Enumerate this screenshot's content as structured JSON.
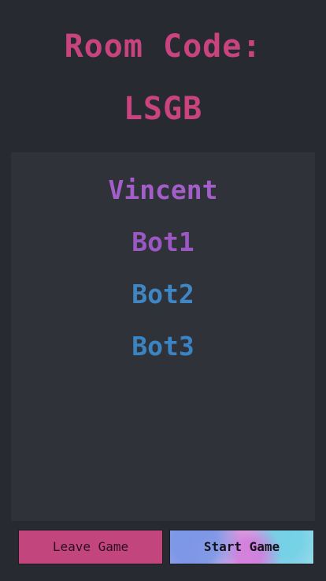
{
  "room": {
    "label": "Room Code:",
    "code": "LSGB"
  },
  "players": [
    {
      "name": "Vincent",
      "color": "#a45ec9"
    },
    {
      "name": "Bot1",
      "color": "#9b57c2"
    },
    {
      "name": "Bot2",
      "color": "#3f86c4"
    },
    {
      "name": "Bot3",
      "color": "#3a84c4"
    }
  ],
  "buttons": {
    "leave_label": "Leave Game",
    "start_label": "Start Game"
  },
  "colors": {
    "background": "#272a30",
    "panel": "#2f3239",
    "accent": "#c9447f"
  }
}
